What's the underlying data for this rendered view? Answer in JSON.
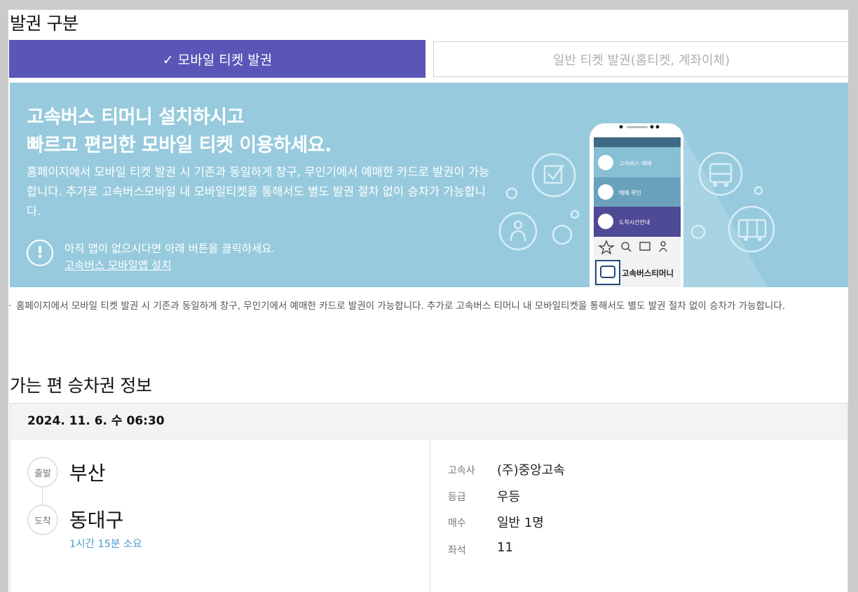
{
  "ticket_type": {
    "title": "발권 구분",
    "tab_mobile": "✓ 모바일 티켓 발권",
    "tab_normal": "일반 티켓 발권(홈티켓, 계좌이체)"
  },
  "banner": {
    "headline_line1": "고속버스 티머니 설치하시고",
    "headline_line2": "빠르고 편리한 모바일 티켓 이용하세요.",
    "desc": "홈페이지에서 모바일 티켓 발권 시 기존과 동일하게 창구, 무인기에서 예매한 카드로 발권이 가능합니다. 추가로 고속버스모바일 내 모바일티켓을 통해서도 별도 발권 절차 없이 승차가 가능합니다.",
    "notice": "아직 앱이 없으시다면 아래 버튼을 클릭하세요.",
    "install_link": "고속버스 모바일앱 설치",
    "phone": {
      "menu1": "고속버스 예매",
      "menu2": "예매 확인",
      "menu3": "도착시간안내",
      "app_name": "고속버스티머니"
    }
  },
  "note": "홈페이지에서 모바일 티켓 발권 시 기존과 동일하게 창구, 무인기에서 예매한 카드로 발권이 가능합니다. 추가로 고속버스 티머니 내 모바일티켓을 통해서도 별도 발권 절차 없이 승차가 가능합니다.",
  "trip": {
    "title": "가는 편 승차권 정보",
    "datetime": "2024. 11. 6. 수 06:30",
    "depart_label": "출발",
    "depart_city": "부산",
    "arrive_label": "도착",
    "arrive_city": "동대구",
    "duration": "1시간 15분 소요",
    "info": [
      {
        "label": "고속사",
        "value": "(주)중앙고속"
      },
      {
        "label": "등급",
        "value": "우등"
      },
      {
        "label": "매수",
        "value": "일반 1명"
      },
      {
        "label": "좌석",
        "value": "11"
      }
    ]
  },
  "colors": {
    "accent": "#5a55b7",
    "banner": "#97cadd",
    "link": "#4a9bd0"
  }
}
